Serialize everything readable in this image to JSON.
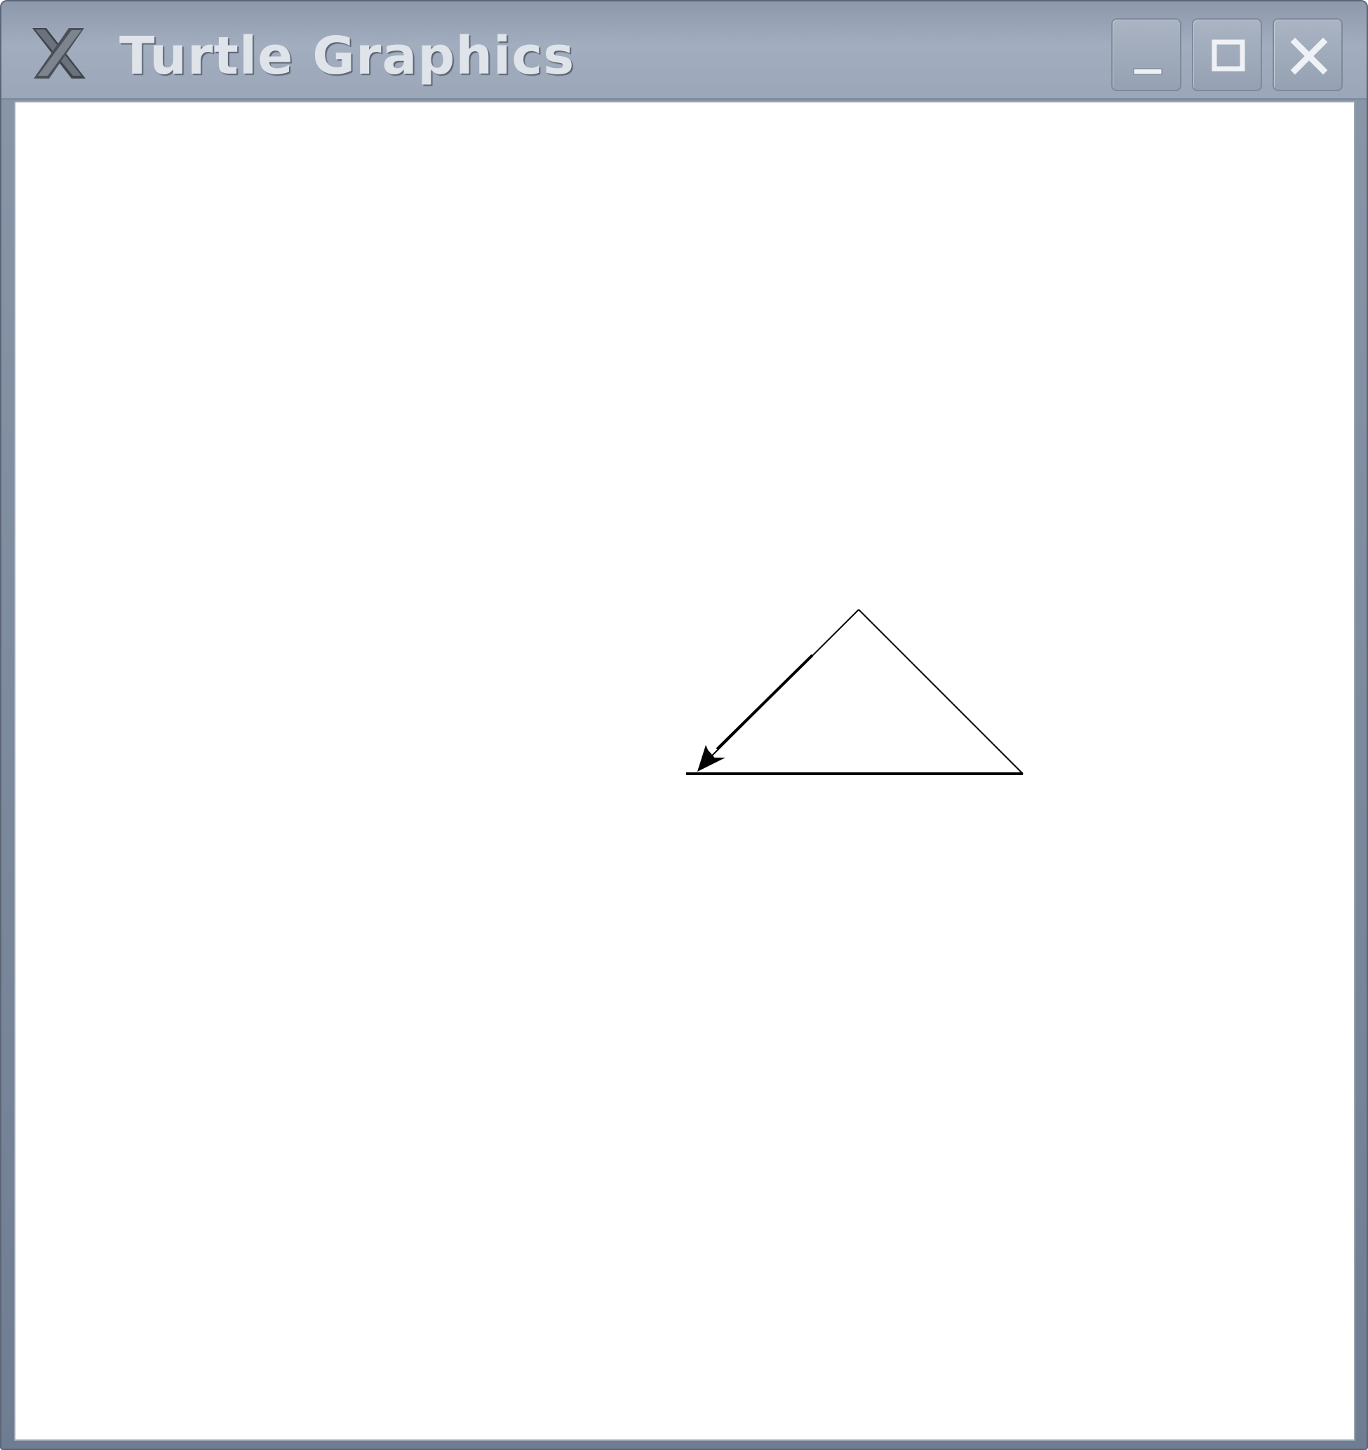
{
  "window": {
    "title": "Turtle Graphics"
  },
  "titlebar_buttons": {
    "minimize_icon": "minimize-icon",
    "maximize_icon": "maximize-icon",
    "close_icon": "close-icon"
  },
  "colors": {
    "titlebar": "#9ba7b8",
    "title_text": "#dfe4ea",
    "canvas_background": "#ffffff",
    "pen": "#000000"
  }
}
